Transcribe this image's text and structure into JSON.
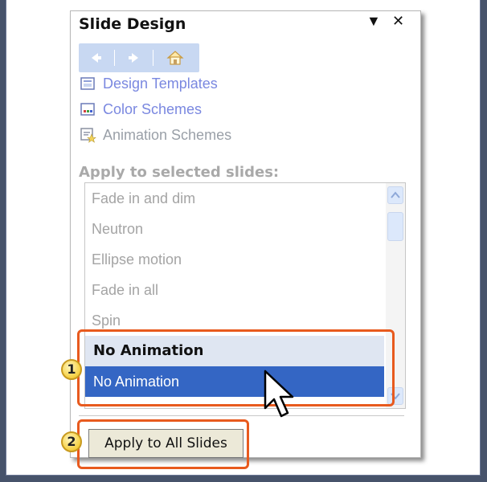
{
  "pane": {
    "title": "Slide Design",
    "dropdown_glyph": "▼",
    "close_glyph": "✕"
  },
  "nav": {
    "back_icon": "back-arrow-icon",
    "forward_icon": "forward-arrow-icon",
    "home_icon": "home-icon"
  },
  "links": [
    {
      "label": "Design Templates",
      "icon": "design-templates-icon"
    },
    {
      "label": "Color Schemes",
      "icon": "color-schemes-icon"
    },
    {
      "label": "Animation Schemes",
      "icon": "animation-schemes-icon"
    }
  ],
  "apply_label": "Apply to selected slides:",
  "list": {
    "items": [
      "Fade in and dim",
      "Neutron",
      "Ellipse motion",
      "Fade in all",
      "Spin"
    ],
    "header": "No Animation",
    "selected": "No Animation"
  },
  "callouts": [
    "1",
    "2"
  ],
  "apply_all_button": "Apply to All Slides",
  "colors": {
    "background": "#47536b",
    "highlight": "#e85a1e",
    "selection": "#3466c4",
    "link": "#7a88e0"
  }
}
